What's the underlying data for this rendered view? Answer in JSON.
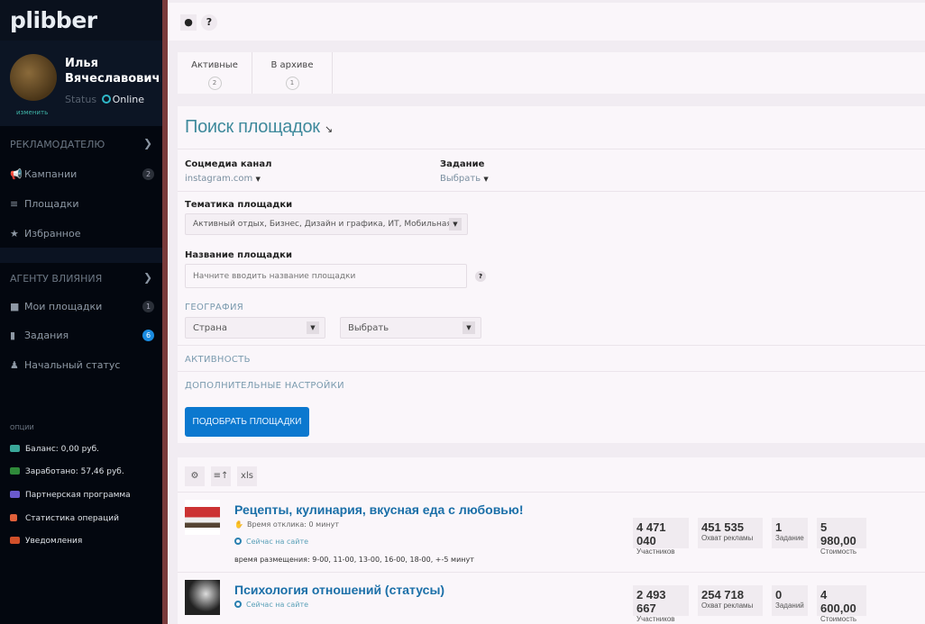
{
  "sidebar": {
    "logo": "plibber",
    "user": {
      "first": "Илья",
      "last": "Вячеславович",
      "change": "изменить",
      "status_label": "Status",
      "status": "Online"
    },
    "sections": [
      {
        "title": "РЕКЛАМОДАТЕЛЮ",
        "items": [
          {
            "label": "Кампании",
            "badge": "2"
          },
          {
            "label": "Площадки"
          },
          {
            "label": "Избранное"
          }
        ]
      },
      {
        "title": "АГЕНТУ ВЛИЯНИЯ",
        "items": [
          {
            "label": "Мои площадки",
            "badge": "1"
          },
          {
            "label": "Задания",
            "badge": "6"
          },
          {
            "label": "Начальный статус"
          }
        ]
      }
    ],
    "options_title": "ОПЦИИ",
    "options": [
      {
        "label": "Баланс: 0,00 руб.",
        "color": "#3aa89a"
      },
      {
        "label": "Заработано: 57,46 руб.",
        "color": "#2f8a3a"
      },
      {
        "label": "Партнерская программа",
        "color": "#6a5acd"
      },
      {
        "label": "Статистика операций",
        "color": "#e0603a"
      },
      {
        "label": "Уведомления",
        "color": "#d2502a"
      }
    ]
  },
  "topbar": {
    "pin": "⬤",
    "help": "?"
  },
  "tabs": [
    {
      "label": "Активные",
      "count": "2"
    },
    {
      "label": "В архиве",
      "count": "1"
    }
  ],
  "search": {
    "title": "Поиск площадок",
    "channel_label": "Соцмедиа канал",
    "channel_value": "instagram.com",
    "task_label": "Задание",
    "task_value": "Выбрать",
    "topic_label": "Тематика площадки",
    "topic_value": "Активный отдых, Бизнес, Дизайн и графика, ИТ, Мобильная",
    "name_label": "Название площадки",
    "name_placeholder": "Начните вводить название площадки",
    "geo_label": "ГЕОГРАФИЯ",
    "country": "Страна",
    "region": "Выбрать",
    "activity": "АКТИВНОСТЬ",
    "advanced": "ДОПОЛНИТЕЛЬНЫЕ НАСТРОЙКИ",
    "submit": "ПОДОБРАТЬ ПЛОЩАДКИ"
  },
  "results": {
    "toolbar": {
      "xls": "xls"
    },
    "items": [
      {
        "title": "Рецепты, кулинария, вкусная еда с любовью!",
        "response": "Время отклика: 0 минут",
        "online": "Сейчас на сайте",
        "schedule": "время размещения: 9-00, 11-00, 13-00, 16-00, 18-00, +-5 минут",
        "stats": [
          {
            "v": "4 471 040",
            "l": "Участников"
          },
          {
            "v": "451 535",
            "l": "Охват рекламы"
          },
          {
            "v": "1",
            "l": "Задание"
          },
          {
            "v": "5 980,00",
            "l": "Стоимость"
          }
        ]
      },
      {
        "title": "Психология отношений (статусы)",
        "online": "Сейчас на сайте",
        "stats": [
          {
            "v": "2 493 667",
            "l": "Участников"
          },
          {
            "v": "254 718",
            "l": "Охват рекламы"
          },
          {
            "v": "0",
            "l": "Заданий"
          },
          {
            "v": "4 600,00",
            "l": "Стоимость"
          }
        ]
      }
    ]
  }
}
